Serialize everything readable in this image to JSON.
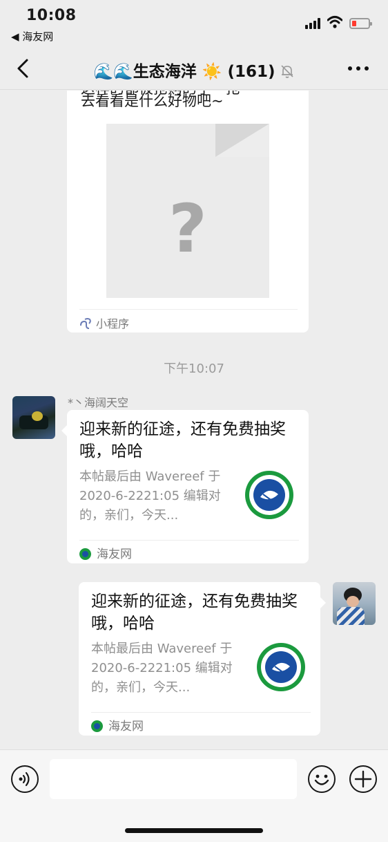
{
  "status_bar": {
    "time": "10:08",
    "back_app_label": "◀ 海友网",
    "battery_level_fraction": 0.25,
    "battery_color": "#ff3b30"
  },
  "nav": {
    "emoji": "🌊🌊",
    "group_name": "生态海洋",
    "sun_emoji": "☀️",
    "member_count": "(161)",
    "back_icon": "chevron-left-icon",
    "mute_icon": "bell-off-icon",
    "more_icon": "ellipsis-icon"
  },
  "messages": {
    "mini_program": {
      "text_cut": "这样的都被抢购的了一抢",
      "text": "去看看是什么好物吧~",
      "placeholder_glyph": "?",
      "footer_label": "小程序",
      "footer_icon": "mini-program-icon"
    },
    "timestamp": "下午10:07",
    "incoming": {
      "sender": "*丶海阔天空",
      "title": "迎来新的征途，还有免费抽奖哦，哈哈",
      "description": "本帖最后由 Wavereef 于 2020-6-2221:05 编辑对的，亲们，今天...",
      "source": "海友网",
      "source_icon": "haiyou-logo-icon"
    },
    "outgoing": {
      "title": "迎来新的征途，还有免费抽奖哦，哈哈",
      "description": "本帖最后由 Wavereef 于 2020-6-2221:05 编辑对的，亲们，今天...",
      "source": "海友网",
      "source_icon": "haiyou-logo-icon"
    }
  },
  "input_bar": {
    "value": "",
    "voice_icon": "voice-icon",
    "emoji_icon": "smiley-icon",
    "plus_icon": "plus-icon"
  },
  "colors": {
    "background": "#ededed",
    "bubble": "#ffffff",
    "logo_green": "#1b9a3e",
    "logo_blue": "#1a4fa3"
  }
}
